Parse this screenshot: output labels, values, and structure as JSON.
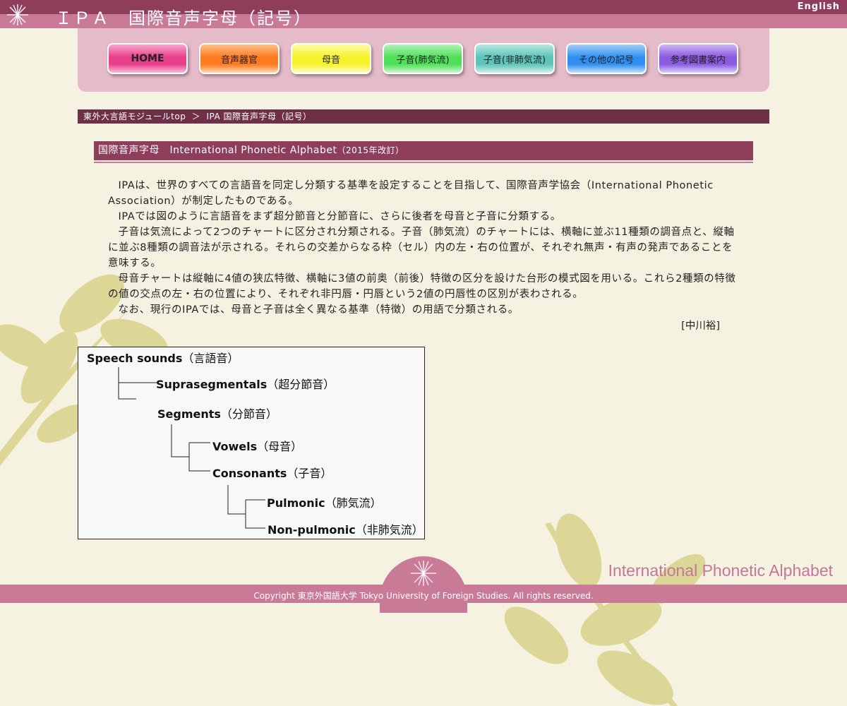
{
  "header": {
    "title": "ＩＰＡ　国際音声字母（記号）",
    "lang_link": "English",
    "logo_icon": "snowflake-star-icon"
  },
  "nav": {
    "buttons": [
      {
        "label": "HOME",
        "color": "#e83f8a"
      },
      {
        "label": "音声器官",
        "color": "#ff7a1e"
      },
      {
        "label": "母音",
        "color": "#f6f22c"
      },
      {
        "label": "子音(肺気流)",
        "color": "#4fe05a"
      },
      {
        "label": "子音(非肺気流)",
        "color": "#5cc4b8"
      },
      {
        "label": "その他の記号",
        "color": "#2f8ff0"
      },
      {
        "label": "参考図書案内",
        "color": "#8a5ae0"
      }
    ]
  },
  "breadcrumb": {
    "root": "東外大言語モジュールtop",
    "separator": "＞",
    "current": "IPA 国際音声字母（記号）"
  },
  "section": {
    "heading": "国際音声字母　International Phonetic Alphabet",
    "heading_note": "（2015年改訂）"
  },
  "content": {
    "paragraphs": [
      "IPAは、世界のすべての言語音を同定し分類する基準を設定することを目指して、国際音声学協会（International Phonetic Association）が制定したものである。",
      "IPAでは図のように言語音をまず超分節音と分節音に、さらに後者を母音と子音に分類する。",
      "子音は気流によって2つのチャートに区分され分類される。子音（肺気流）のチャートには、横軸に並ぶ11種類の調音点と、縦軸に並ぶ8種類の調音法が示される。それらの交差からなる枠（セル）内の左・右の位置が、それぞれ無声・有声の発声であることを意味する。",
      "母音チャートは縦軸に4値の狭広特徴、横軸に3値の前奥（前後）特徴の区分を設けた台形の模式図を用いる。これら2種類の特徴の値の交点の左・右の位置により、それぞれ非円唇・円唇という2値の円唇性の区別が表わされる。",
      "なお、現行のIPAでは、母音と子音は全く異なる基準（特徴）の用語で分類される。"
    ],
    "author": "[中川裕]"
  },
  "diagram": {
    "nodes": [
      {
        "en": "Speech sounds",
        "ja": "（言語音）"
      },
      {
        "en": "Suprasegmentals",
        "ja": "（超分節音）"
      },
      {
        "en": "Segments",
        "ja": "（分節音）"
      },
      {
        "en": "Vowels",
        "ja": "（母音）"
      },
      {
        "en": "Consonants",
        "ja": "（子音）"
      },
      {
        "en": "Pulmonic",
        "ja": "（肺気流）"
      },
      {
        "en": "Non-pulmonic",
        "ja": "（非肺気流）"
      }
    ]
  },
  "footer": {
    "title": "International Phonetic Alphabet",
    "copyright": "Copyright 東京外国語大学 Tokyo University of Foreign Studies. All rights reserved."
  }
}
